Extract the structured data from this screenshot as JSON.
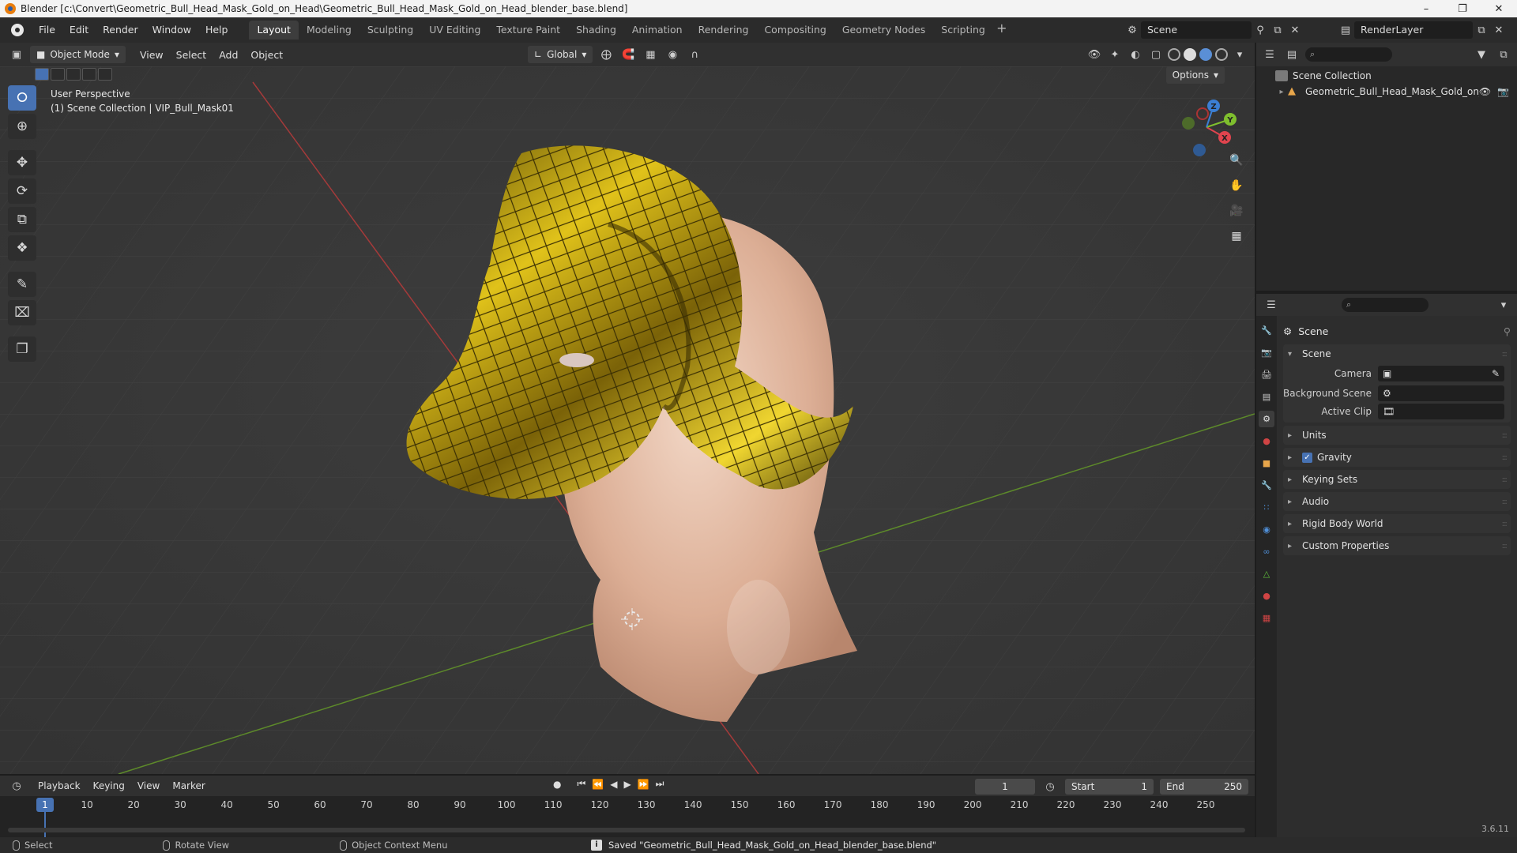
{
  "window": {
    "title": "Blender [c:\\Convert\\Geometric_Bull_Head_Mask_Gold_on_Head\\Geometric_Bull_Head_Mask_Gold_on_Head_blender_base.blend]"
  },
  "menu": [
    "File",
    "Edit",
    "Render",
    "Window",
    "Help"
  ],
  "workspaces": {
    "tabs": [
      "Layout",
      "Modeling",
      "Sculpting",
      "UV Editing",
      "Texture Paint",
      "Shading",
      "Animation",
      "Rendering",
      "Compositing",
      "Geometry Nodes",
      "Scripting"
    ],
    "active": "Layout"
  },
  "scene_name": "Scene",
  "render_layer": "RenderLayer",
  "viewport": {
    "mode": "Object Mode",
    "menus": [
      "View",
      "Select",
      "Add",
      "Object"
    ],
    "orientation": "Global",
    "options_label": "Options",
    "perspective": "User Perspective",
    "collection_info": "(1) Scene Collection | VIP_Bull_Mask01",
    "gizmo_axes": {
      "x": "X",
      "y": "Y",
      "z": "Z"
    }
  },
  "outliner": {
    "root": "Scene Collection",
    "items": [
      {
        "label": "Geometric_Bull_Head_Mask_Gold_on_H"
      }
    ]
  },
  "properties": {
    "context_title": "Scene",
    "panel_title": "Scene",
    "fields": {
      "camera_label": "Camera",
      "background_scene_label": "Background Scene",
      "active_clip_label": "Active Clip"
    },
    "panels": [
      "Units",
      "Gravity",
      "Keying Sets",
      "Audio",
      "Rigid Body World",
      "Custom Properties"
    ],
    "gravity_checked": true,
    "version": "3.6.11"
  },
  "timeline": {
    "menus": [
      "Playback",
      "Keying",
      "View",
      "Marker"
    ],
    "current_frame": "1",
    "start_label": "Start",
    "start": "1",
    "end_label": "End",
    "end": "250",
    "ruler": [
      "10",
      "20",
      "30",
      "40",
      "50",
      "60",
      "70",
      "80",
      "90",
      "100",
      "110",
      "120",
      "130",
      "140",
      "150",
      "160",
      "170",
      "180",
      "190",
      "200",
      "210",
      "220",
      "230",
      "240",
      "250"
    ]
  },
  "statusbar": {
    "select": "Select",
    "rotate": "Rotate View",
    "context": "Object Context Menu",
    "message": "Saved \"Geometric_Bull_Head_Mask_Gold_on_Head_blender_base.blend\""
  },
  "colors": {
    "accent": "#4772b3",
    "gold": "#c9a416",
    "skin": "#e8c0a8",
    "axis_x": "#e0444e",
    "axis_y": "#7fbf2e",
    "axis_z": "#3b7fd4"
  }
}
